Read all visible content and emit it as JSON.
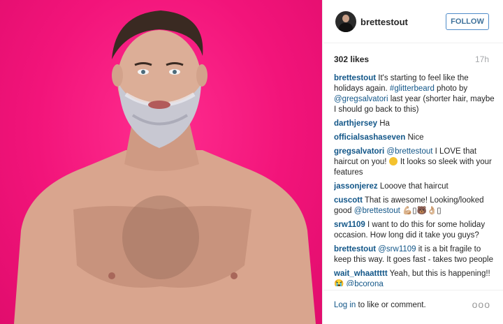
{
  "post": {
    "photo_description_icon": "portrait-photo",
    "accent_bg": "#f2147a"
  },
  "header": {
    "username": "brettestout",
    "follow_label": "FOLLOW"
  },
  "stats": {
    "likes": "302 likes",
    "time": "17h"
  },
  "comments": [
    {
      "user": "brettestout",
      "parts": [
        {
          "type": "text",
          "value": " It's starting to feel like the holidays again. "
        },
        {
          "type": "mention",
          "value": "#glitterbeard"
        },
        {
          "type": "text",
          "value": " photo by "
        },
        {
          "type": "mention",
          "value": "@gregsalvatori"
        },
        {
          "type": "text",
          "value": " last year (shorter hair, maybe I should go back to this)"
        }
      ]
    },
    {
      "user": "darthjersey",
      "parts": [
        {
          "type": "text",
          "value": " Ha"
        }
      ]
    },
    {
      "user": "officialsashaseven",
      "parts": [
        {
          "type": "text",
          "value": " Nice"
        }
      ]
    },
    {
      "user": "gregsalvatori",
      "parts": [
        {
          "type": "mention",
          "value": " @brettestout"
        },
        {
          "type": "text",
          "value": " I LOVE that haircut on you! "
        },
        {
          "type": "emoji",
          "value": "#f4c22e"
        },
        {
          "type": "text",
          "value": " It looks so sleek with your features"
        }
      ]
    },
    {
      "user": "jassonjerez",
      "parts": [
        {
          "type": "text",
          "value": " Looove that haircut"
        }
      ]
    },
    {
      "user": "cuscott",
      "parts": [
        {
          "type": "text",
          "value": " That is awesome! Looking/looked good "
        },
        {
          "type": "mention",
          "value": "@brettestout"
        },
        {
          "type": "text",
          "value": " 💪🏼▯🐻👌🏼▯"
        }
      ]
    },
    {
      "user": "srw1109",
      "parts": [
        {
          "type": "text",
          "value": " I want to do this for some holiday occasion. How long did it take you guys?"
        }
      ]
    },
    {
      "user": "brettestout",
      "parts": [
        {
          "type": "mention",
          "value": " @srw1109"
        },
        {
          "type": "text",
          "value": " it is a bit fragile to keep this way. It goes fast - takes two people"
        }
      ]
    },
    {
      "user": "wait_whaattttt",
      "parts": [
        {
          "type": "text",
          "value": " Yeah, but this is happening!! 😭 "
        },
        {
          "type": "mention",
          "value": "@bcorona_____"
        }
      ]
    }
  ],
  "footer": {
    "login_link": "Log in",
    "login_rest": " to like or comment.",
    "more_label": "ooo"
  }
}
